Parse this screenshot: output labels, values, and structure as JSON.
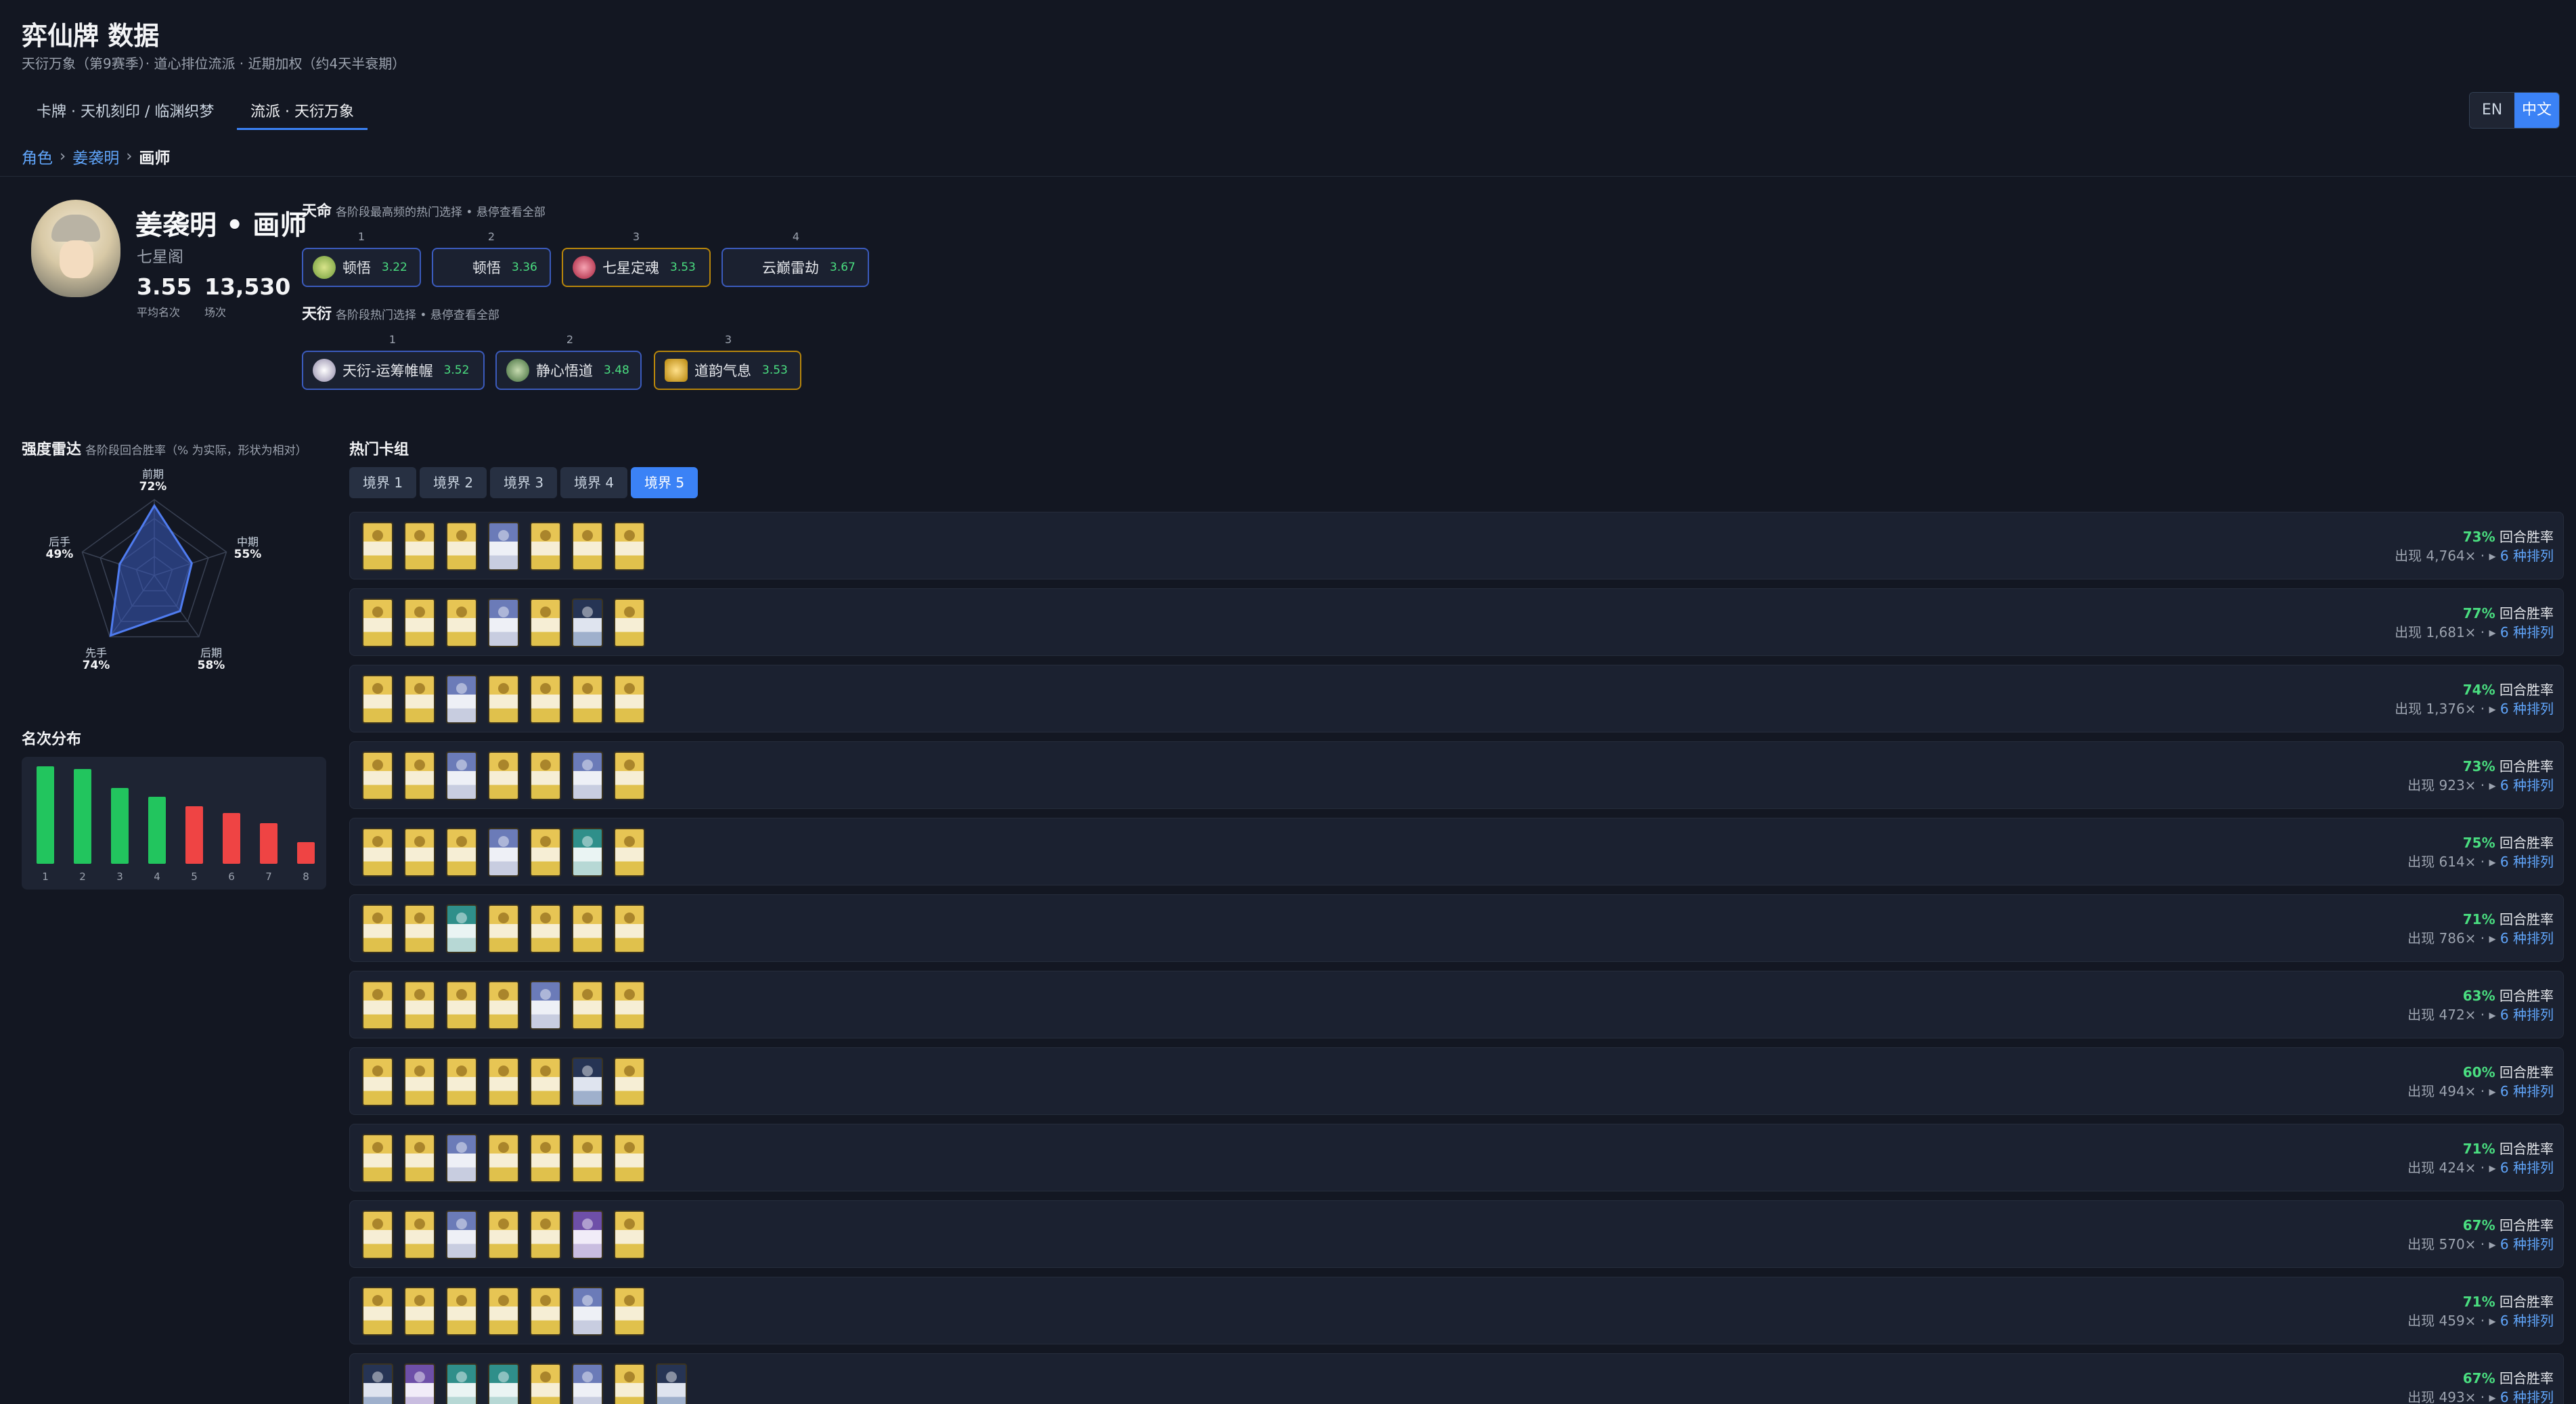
{
  "header": {
    "title": "弈仙牌 数据",
    "subtitle": "天衍万象（第9赛季）· 道心排位流派 · 近期加权（约4天半衰期）"
  },
  "nav": {
    "tabs": [
      {
        "label": "卡牌 · 天机刻印 / 临渊织梦",
        "active": false
      },
      {
        "label": "流派 · 天衍万象",
        "active": true
      }
    ]
  },
  "lang": {
    "en": "EN",
    "zh": "中文",
    "active": "zh"
  },
  "breadcrumb": {
    "root": "角色",
    "sep": "›",
    "character": "姜袭明",
    "current": "画师"
  },
  "profile": {
    "name": "姜袭明 • 画师",
    "faction": "七星阁",
    "avg_rank": "3.55",
    "avg_rank_label": "平均名次",
    "games": "13,530",
    "games_label": "场次"
  },
  "destiny": {
    "title": "天命",
    "hint": "各阶段最高频的热门选择 • 悬停查看全部",
    "picks": [
      {
        "rank": "1",
        "name": "顿悟",
        "score": "3.22",
        "icon_color": "#8bb04a",
        "icon": "orb-icon"
      },
      {
        "rank": "2",
        "name": "顿悟",
        "score": "3.36",
        "icon_color": "",
        "icon": ""
      },
      {
        "rank": "3",
        "name": "七星定魂",
        "score": "3.53",
        "icon_color": "#c0304a",
        "icon": "star-seal-icon"
      },
      {
        "rank": "4",
        "name": "云巅雷劫",
        "score": "3.67",
        "icon_color": "",
        "icon": ""
      }
    ]
  },
  "tianyan": {
    "title": "天衍",
    "hint": "各阶段热门选择 • 悬停查看全部",
    "picks": [
      {
        "rank": "1",
        "name": "天衍-运筹帷幄",
        "score": "3.52",
        "icon_color": "#d9d4e6",
        "icon": "scroll-icon"
      },
      {
        "rank": "2",
        "name": "静心悟道",
        "score": "3.48",
        "icon_color": "#5f8a54",
        "icon": "meditation-icon"
      },
      {
        "rank": "3",
        "name": "道韵气息",
        "score": "3.53",
        "icon_color": "#d9a520",
        "icon": "aura-icon"
      }
    ]
  },
  "radar": {
    "title": "强度雷达",
    "hint": "各阶段回合胜率（% 为实际，形状为相对）",
    "axes": [
      {
        "label": "前期",
        "value": "72%"
      },
      {
        "label": "中期",
        "value": "55%"
      },
      {
        "label": "后期",
        "value": "58%"
      },
      {
        "label": "先手",
        "value": "74%"
      },
      {
        "label": "后手",
        "value": "49%"
      }
    ],
    "relative": [
      0.92,
      0.52,
      0.58,
      0.98,
      0.48
    ]
  },
  "distribution": {
    "title": "名次分布",
    "ranks": [
      "1",
      "2",
      "3",
      "4",
      "5",
      "6",
      "7",
      "8"
    ],
    "values": [
      1.0,
      0.97,
      0.78,
      0.69,
      0.59,
      0.52,
      0.42,
      0.22
    ],
    "colors": [
      "#22c55e",
      "#22c55e",
      "#22c55e",
      "#22c55e",
      "#ef4444",
      "#ef4444",
      "#ef4444",
      "#ef4444"
    ]
  },
  "decks": {
    "title": "热门卡组",
    "realm_tabs": [
      "境界 1",
      "境界 2",
      "境界 3",
      "境界 4",
      "境界 5"
    ],
    "active_realm": 4,
    "win_label": "回合胜率",
    "appear_prefix": "出现",
    "rows": [
      {
        "win": "73%",
        "count": "4,764×",
        "variants": "6 种排列",
        "cards": [
          "c",
          "c",
          "c",
          "b",
          "c",
          "c",
          "c"
        ]
      },
      {
        "win": "77%",
        "count": "1,681×",
        "variants": "6 种排列",
        "cards": [
          "c",
          "c",
          "c",
          "b",
          "c",
          "n",
          "c"
        ]
      },
      {
        "win": "74%",
        "count": "1,376×",
        "variants": "6 种排列",
        "cards": [
          "c",
          "c",
          "b",
          "c",
          "c",
          "c",
          "c"
        ]
      },
      {
        "win": "73%",
        "count": "923×",
        "variants": "6 种排列",
        "cards": [
          "c",
          "c",
          "b",
          "c",
          "c",
          "b",
          "c"
        ]
      },
      {
        "win": "75%",
        "count": "614×",
        "variants": "6 种排列",
        "cards": [
          "c",
          "c",
          "c",
          "b",
          "c",
          "t",
          "c"
        ]
      },
      {
        "win": "71%",
        "count": "786×",
        "variants": "6 种排列",
        "cards": [
          "c",
          "c",
          "t",
          "c",
          "c",
          "c",
          "c"
        ]
      },
      {
        "win": "63%",
        "count": "472×",
        "variants": "6 种排列",
        "cards": [
          "c",
          "c",
          "c",
          "c",
          "b",
          "c",
          "c"
        ]
      },
      {
        "win": "60%",
        "count": "494×",
        "variants": "6 种排列",
        "cards": [
          "c",
          "c",
          "c",
          "c",
          "c",
          "n",
          "c"
        ]
      },
      {
        "win": "71%",
        "count": "424×",
        "variants": "6 种排列",
        "cards": [
          "c",
          "c",
          "b",
          "c",
          "c",
          "c",
          "c"
        ]
      },
      {
        "win": "67%",
        "count": "570×",
        "variants": "6 种排列",
        "cards": [
          "c",
          "c",
          "b",
          "c",
          "c",
          "p",
          "c"
        ]
      },
      {
        "win": "71%",
        "count": "459×",
        "variants": "6 种排列",
        "cards": [
          "c",
          "c",
          "c",
          "c",
          "c",
          "b",
          "c"
        ]
      },
      {
        "win": "67%",
        "count": "493×",
        "variants": "6 种排列",
        "cards": [
          "n",
          "p",
          "t",
          "t",
          "c",
          "b",
          "c",
          "n"
        ]
      }
    ]
  }
}
